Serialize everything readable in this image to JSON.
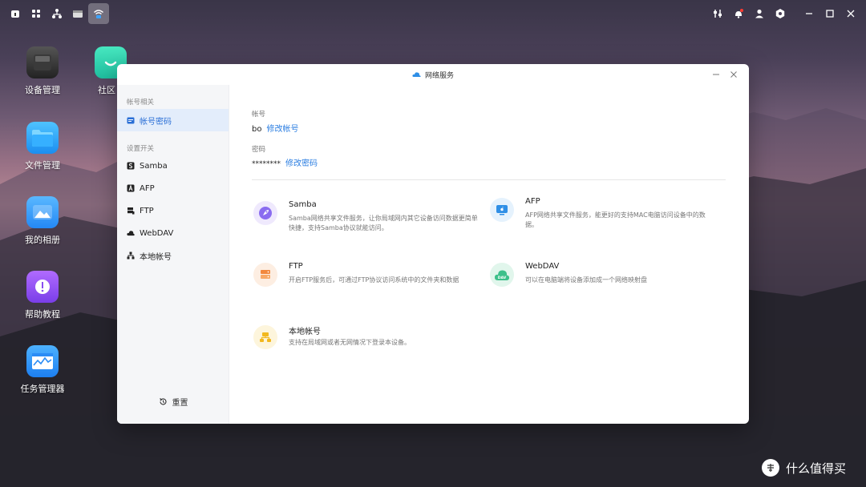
{
  "topbar": {
    "left_icons": [
      "home-icon",
      "apps-icon",
      "network-icon",
      "window-icon",
      "wifi-icon"
    ],
    "right_icons": [
      "sliders-icon",
      "bell-icon",
      "user-icon",
      "gear-icon",
      "minimize-icon",
      "maximize-icon",
      "close-icon"
    ]
  },
  "desktop": {
    "items": [
      {
        "label": "设备管理",
        "icon": "device-icon"
      },
      {
        "label": "社区",
        "icon": "community-icon"
      },
      {
        "label": "文件管理",
        "icon": "folder-icon"
      },
      {
        "label": "我的相册",
        "icon": "photo-icon"
      },
      {
        "label": "帮助教程",
        "icon": "help-icon"
      },
      {
        "label": "任务管理器",
        "icon": "task-manager-icon"
      }
    ]
  },
  "window": {
    "title": "网络服务",
    "sidebar": {
      "section_account": "帐号相关",
      "item_account_password": "帐号密码",
      "section_switches": "设置开关",
      "items": [
        {
          "label": "Samba",
          "icon": "samba-icon"
        },
        {
          "label": "AFP",
          "icon": "afp-icon"
        },
        {
          "label": "FTP",
          "icon": "ftp-icon"
        },
        {
          "label": "WebDAV",
          "icon": "cloud-icon"
        },
        {
          "label": "本地帐号",
          "icon": "local-account-icon"
        }
      ],
      "reset": "重置"
    },
    "account": {
      "label": "帐号",
      "value": "bo",
      "modify": "修改帐号"
    },
    "password": {
      "label": "密码",
      "value": "********",
      "modify": "修改密码"
    },
    "services": [
      {
        "name": "Samba",
        "desc": "Samba网络共享文件服务，让你局域网内其它设备访问数据更简单快捷，支持Samba协议就能访问。",
        "icon": "rocket-icon",
        "color": "#7b5ce0"
      },
      {
        "name": "AFP",
        "desc": "AFP网络共享文件服务，能更好的支持MAC电脑访问设备中的数据。",
        "icon": "mac-icon",
        "color": "#2f8fe6"
      },
      {
        "name": "FTP",
        "desc": "开启FTP服务后，可通过FTP协议访问系统中的文件夹和数据",
        "icon": "ftp-server-icon",
        "color": "#f2883c"
      },
      {
        "name": "WebDAV",
        "desc": "可以在电脑端将设备添加成一个网络映射盘",
        "icon": "dav-cloud-icon",
        "color": "#3cc08a"
      },
      {
        "name": "本地帐号",
        "desc": "支持在局域网或者无网情况下登录本设备。",
        "icon": "local-network-icon",
        "color": "#f2b81e"
      }
    ]
  },
  "watermark": {
    "text": "什么值得买"
  }
}
